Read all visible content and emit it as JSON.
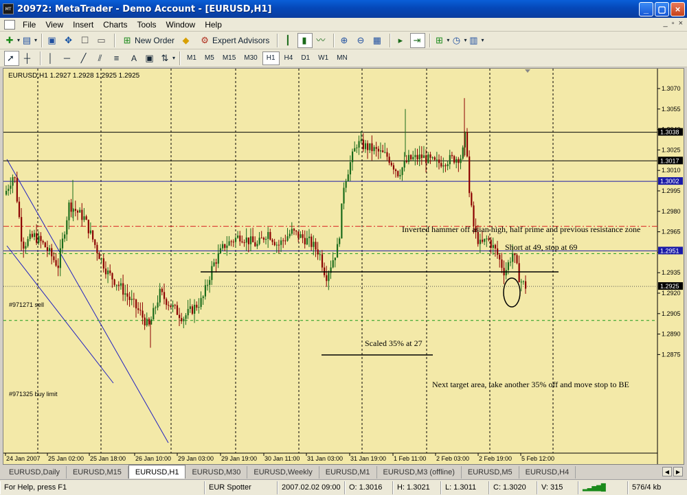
{
  "window": {
    "title": "20972: MetaTrader - Demo Account - [EURUSD,H1]",
    "app_icon_text": "MT",
    "buttons": [
      "_",
      "▢",
      "×"
    ]
  },
  "menu": {
    "items": [
      "File",
      "View",
      "Insert",
      "Charts",
      "Tools",
      "Window",
      "Help"
    ],
    "mdi_controls": [
      "_",
      "▫",
      "×"
    ]
  },
  "toolbar": {
    "new_order": "New Order",
    "expert_advisors": "Expert Advisors",
    "timeframes": [
      "M1",
      "M5",
      "M15",
      "M30",
      "H1",
      "H4",
      "D1",
      "W1",
      "MN"
    ],
    "active_timeframe": "H1",
    "text_tool": "A"
  },
  "chart": {
    "info": "EURUSD,H1  1.2927 1.2928 1.2925 1.2925",
    "background": "#f3e9a8",
    "price_axis": [
      "1.3070",
      "1.3055",
      "1.3040",
      "1.3025",
      "1.3010",
      "1.2995",
      "1.2980",
      "1.2965",
      "1.2950",
      "1.2935",
      "1.2920",
      "1.2905",
      "1.2890",
      "1.2875"
    ],
    "time_axis": [
      "24 Jan 2007",
      "25 Jan 02:00",
      "25 Jan 18:00",
      "26 Jan 10:00",
      "29 Jan 03:00",
      "29 Jan 19:00",
      "30 Jan 11:00",
      "31 Jan 03:00",
      "31 Jan 19:00",
      "1 Feb 11:00",
      "2 Feb 03:00",
      "2 Feb 19:00",
      "5 Feb 12:00"
    ],
    "price_labels": [
      {
        "text": "1.3038",
        "price": 1.3038,
        "color": "#000000"
      },
      {
        "text": "1.3017",
        "price": 1.3017,
        "color": "#000000"
      },
      {
        "text": "1.3002",
        "price": 1.3002,
        "color": "#1a1aa8"
      },
      {
        "text": "1.2951",
        "price": 1.2951,
        "color": "#1a1aa8"
      },
      {
        "text": "1.2925",
        "price": 1.2925,
        "color": "#000000"
      }
    ],
    "order_labels": [
      "#971271 sell",
      "#971325 buy limit"
    ],
    "annotations": [
      "Inverted hammer off asian high, half prime and previous resistance zone",
      "Short at 49, stop at 69",
      "Scaled 35% at 27",
      "Next target area, take another 35% off and move stop to BE"
    ],
    "colors": {
      "bull": "#1a6b1a",
      "bear": "#8b0000",
      "sell_line": "#1a1aa8",
      "stop_line": "#d92020",
      "take_line": "#1a9a1a"
    }
  },
  "tabs": {
    "items": [
      "EURUSD,Daily",
      "EURUSD,M15",
      "EURUSD,H1",
      "EURUSD,M30",
      "EURUSD,Weekly",
      "EURUSD,M1",
      "EURUSD,M3 (offline)",
      "EURUSD,M5",
      "EURUSD,H4"
    ],
    "active": "EURUSD,H1"
  },
  "status": {
    "help": "For Help, press F1",
    "profile": "EUR Spotter",
    "time": "2007.02.02 09:00",
    "open": "O: 1.3016",
    "high": "H: 1.3021",
    "low": "L: 1.3011",
    "close": "C: 1.3020",
    "volume": "V: 315",
    "traffic": "576/4 kb"
  }
}
